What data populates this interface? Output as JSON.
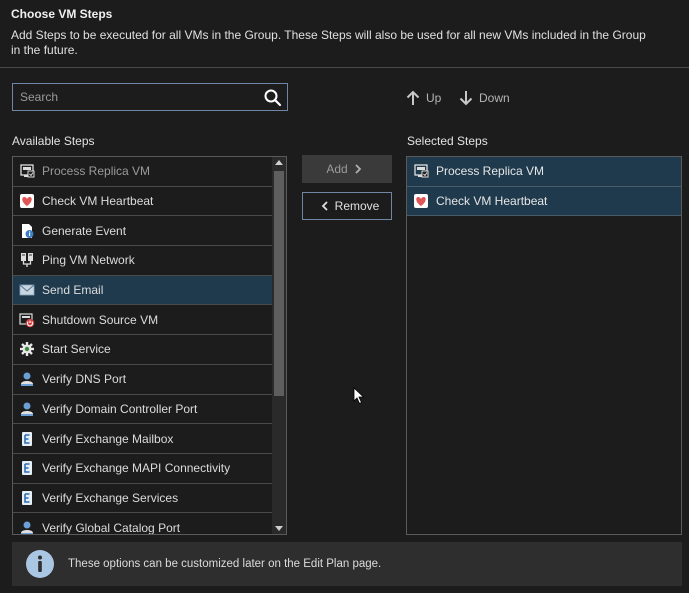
{
  "header": {
    "title": "Choose VM Steps",
    "description": "Add Steps to be executed for all VMs in the Group. These Steps will also be used for all new VMs included in the Group in the future."
  },
  "search": {
    "placeholder": "Search",
    "icon": "search-icon"
  },
  "order_controls": {
    "up_label": "Up",
    "down_label": "Down"
  },
  "available": {
    "label": "Available Steps",
    "items": [
      {
        "label": "Process Replica VM",
        "icon": "replica-vm-icon",
        "state": "disabled"
      },
      {
        "label": "Check VM Heartbeat",
        "icon": "heartbeat-icon",
        "state": "normal"
      },
      {
        "label": "Generate Event",
        "icon": "event-icon",
        "state": "normal"
      },
      {
        "label": "Ping VM Network",
        "icon": "network-icon",
        "state": "normal"
      },
      {
        "label": "Send Email",
        "icon": "email-icon",
        "state": "selected"
      },
      {
        "label": "Shutdown Source VM",
        "icon": "shutdown-icon",
        "state": "normal"
      },
      {
        "label": "Start Service",
        "icon": "service-gear-icon",
        "state": "normal"
      },
      {
        "label": "Verify DNS Port",
        "icon": "server-user-icon",
        "state": "normal"
      },
      {
        "label": "Verify Domain Controller Port",
        "icon": "server-user-icon",
        "state": "normal"
      },
      {
        "label": "Verify Exchange Mailbox",
        "icon": "exchange-icon",
        "state": "normal"
      },
      {
        "label": "Verify Exchange MAPI Connectivity",
        "icon": "exchange-icon",
        "state": "normal"
      },
      {
        "label": "Verify Exchange Services",
        "icon": "exchange-icon",
        "state": "normal"
      },
      {
        "label": "Verify Global Catalog Port",
        "icon": "server-user-icon",
        "state": "normal"
      }
    ]
  },
  "buttons": {
    "add_label": "Add",
    "remove_label": "Remove"
  },
  "selected": {
    "label": "Selected Steps",
    "items": [
      {
        "label": "Process Replica VM",
        "icon": "replica-vm-icon"
      },
      {
        "label": "Check VM Heartbeat",
        "icon": "heartbeat-icon"
      }
    ]
  },
  "info": {
    "text": "These options can be customized later on the Edit Plan page.",
    "icon": "info-icon"
  },
  "colors": {
    "background": "#1c1c1c",
    "selection": "#1f3a4d",
    "accent_border": "#6f87a3",
    "info_bar": "#2e2e2e"
  }
}
